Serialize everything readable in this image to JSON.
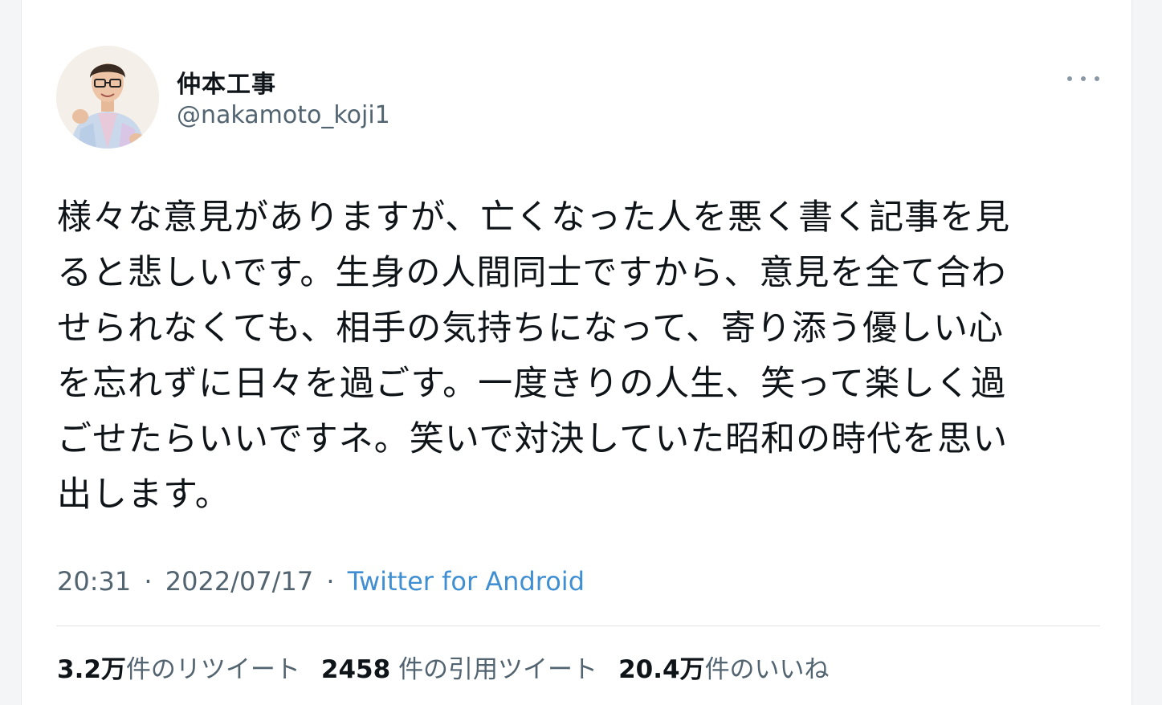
{
  "tweet": {
    "author_name": "仲本工事",
    "author_handle": "@nakamoto_koji1",
    "avatar_icon": "user-avatar-photo",
    "more_icon": "more-horizontal-icon",
    "text": "様々な意見がありますが、亡くなった人を悪く書く記事を見\nると悲しいです。生身の人間同士ですから、意見を全て合わ\nせられなくても、相手の気持ちになって、寄り添う優しい心\nを忘れずに日々を過ごす。一度きりの人生、笑って楽しく過\nごせたらいいですネ。笑いで対決していた昭和の時代を思い\n出します。",
    "time": "20:31",
    "date": "2022/07/17",
    "separator": "·",
    "source": "Twitter for Android"
  },
  "stats": {
    "retweets_count": "3.2万",
    "retweets_label": "件のリツイート",
    "quotes_count": "2458",
    "quotes_label": "件の引用ツイート",
    "likes_count": "20.4万",
    "likes_label": "件のいいね"
  },
  "colors": {
    "text": "#0f1419",
    "secondary": "#536471",
    "link": "#3f8fd2"
  }
}
